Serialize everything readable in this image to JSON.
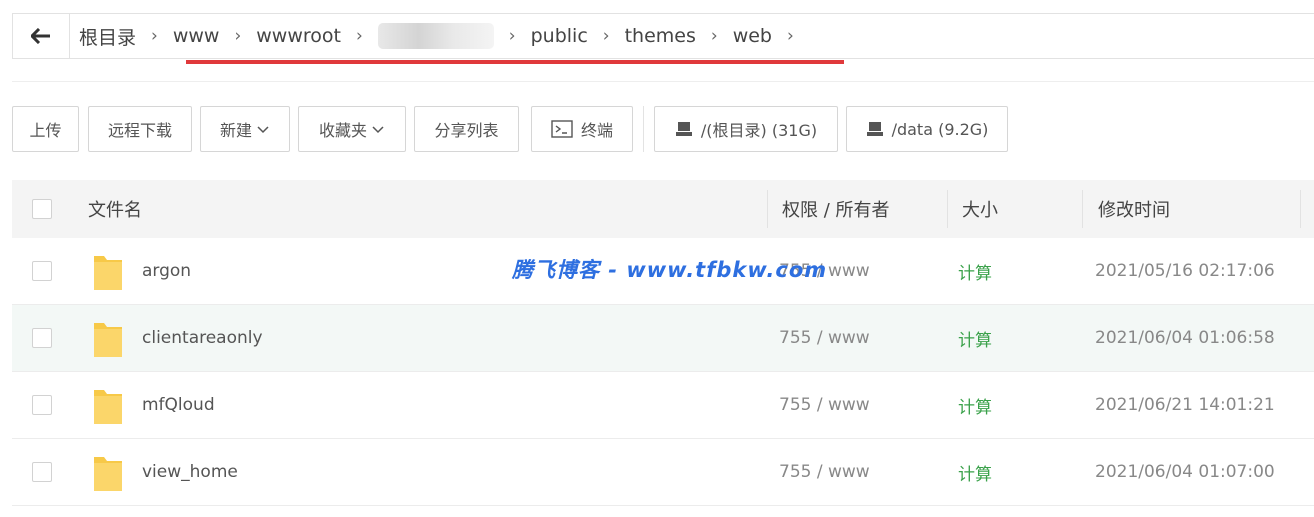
{
  "breadcrumb": {
    "back_icon": "arrow-left-icon",
    "items": [
      "根目录",
      "www",
      "wwwroot",
      "",
      "public",
      "themes",
      "web"
    ],
    "separator": "›"
  },
  "toolbar": {
    "upload": "上传",
    "remote_download": "远程下载",
    "new": "新建",
    "favorites": "收藏夹",
    "share_list": "分享列表",
    "terminal": "终端",
    "disk_root": "/(根目录) (31G)",
    "disk_data": "/data (9.2G)"
  },
  "table": {
    "headers": {
      "name": "文件名",
      "permission": "权限 / 所有者",
      "size": "大小",
      "modified": "修改时间"
    },
    "rows": [
      {
        "name": "argon",
        "permission": "755 / www",
        "size": "计算",
        "modified": "2021/05/16 02:17:06"
      },
      {
        "name": "clientareaonly",
        "permission": "755 / www",
        "size": "计算",
        "modified": "2021/06/04 01:06:58"
      },
      {
        "name": "mfQloud",
        "permission": "755 / www",
        "size": "计算",
        "modified": "2021/06/21 14:01:21"
      },
      {
        "name": "view_home",
        "permission": "755 / www",
        "size": "计算",
        "modified": "2021/06/04 01:07:00"
      }
    ]
  },
  "watermark": "腾飞博客 - www.tfbkw.com",
  "colors": {
    "size_link": "#3aa14a",
    "highlight_line": "#e0393b",
    "watermark": "#2e6fe0",
    "folder": "#f7c948"
  }
}
